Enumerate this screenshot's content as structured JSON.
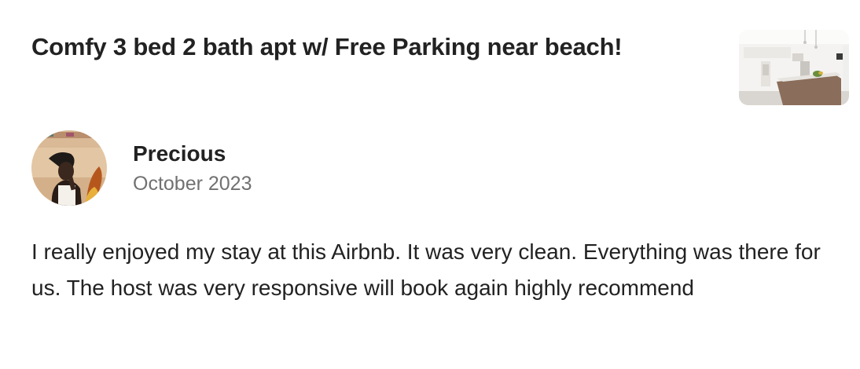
{
  "listing": {
    "title": "Comfy 3 bed 2 bath apt w/ Free Parking near beach!",
    "thumbnail_icon": "kitchen-photo"
  },
  "review": {
    "reviewer_name": "Precious",
    "date": "October 2023",
    "avatar_icon": "reviewer-photo",
    "text": "I really enjoyed my stay at this Airbnb. It was very clean. Everything was there for us. The host was very responsive will book again highly recommend"
  },
  "colors": {
    "primary_text": "#222222",
    "secondary_text": "#717171"
  }
}
